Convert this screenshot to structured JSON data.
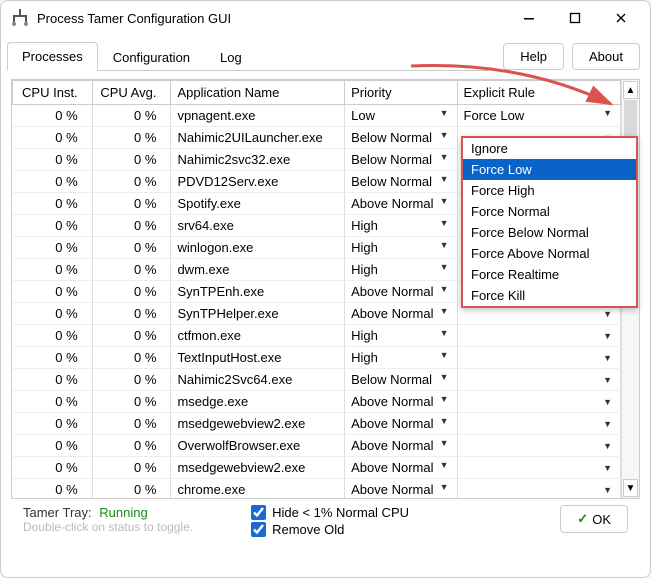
{
  "window": {
    "title": "Process Tamer Configuration GUI"
  },
  "buttons": {
    "help": "Help",
    "about": "About",
    "ok": "OK"
  },
  "tabs": {
    "processes": "Processes",
    "configuration": "Configuration",
    "log": "Log"
  },
  "columns": {
    "cpu_inst": "CPU Inst.",
    "cpu_avg": "CPU Avg.",
    "app_name": "Application Name",
    "priority": "Priority",
    "explicit_rule": "Explicit Rule"
  },
  "rows": [
    {
      "inst": "0 %",
      "avg": "0 %",
      "app": "vpnagent.exe",
      "pri": "Low",
      "rule": "Force Low"
    },
    {
      "inst": "0 %",
      "avg": "0 %",
      "app": "Nahimic2UILauncher.exe",
      "pri": "Below Normal",
      "rule": ""
    },
    {
      "inst": "0 %",
      "avg": "0 %",
      "app": "Nahimic2svc32.exe",
      "pri": "Below Normal",
      "rule": ""
    },
    {
      "inst": "0 %",
      "avg": "0 %",
      "app": "PDVD12Serv.exe",
      "pri": "Below Normal",
      "rule": ""
    },
    {
      "inst": "0 %",
      "avg": "0 %",
      "app": "Spotify.exe",
      "pri": "Above Normal",
      "rule": ""
    },
    {
      "inst": "0 %",
      "avg": "0 %",
      "app": "srv64.exe",
      "pri": "High",
      "rule": ""
    },
    {
      "inst": "0 %",
      "avg": "0 %",
      "app": "winlogon.exe",
      "pri": "High",
      "rule": ""
    },
    {
      "inst": "0 %",
      "avg": "0 %",
      "app": "dwm.exe",
      "pri": "High",
      "rule": ""
    },
    {
      "inst": "0 %",
      "avg": "0 %",
      "app": "SynTPEnh.exe",
      "pri": "Above Normal",
      "rule": ""
    },
    {
      "inst": "0 %",
      "avg": "0 %",
      "app": "SynTPHelper.exe",
      "pri": "Above Normal",
      "rule": ""
    },
    {
      "inst": "0 %",
      "avg": "0 %",
      "app": "ctfmon.exe",
      "pri": "High",
      "rule": ""
    },
    {
      "inst": "0 %",
      "avg": "0 %",
      "app": "TextInputHost.exe",
      "pri": "High",
      "rule": ""
    },
    {
      "inst": "0 %",
      "avg": "0 %",
      "app": "Nahimic2Svc64.exe",
      "pri": "Below Normal",
      "rule": ""
    },
    {
      "inst": "0 %",
      "avg": "0 %",
      "app": "msedge.exe",
      "pri": "Above Normal",
      "rule": ""
    },
    {
      "inst": "0 %",
      "avg": "0 %",
      "app": "msedgewebview2.exe",
      "pri": "Above Normal",
      "rule": ""
    },
    {
      "inst": "0 %",
      "avg": "0 %",
      "app": "OverwolfBrowser.exe",
      "pri": "Above Normal",
      "rule": ""
    },
    {
      "inst": "0 %",
      "avg": "0 %",
      "app": "msedgewebview2.exe",
      "pri": "Above Normal",
      "rule": ""
    },
    {
      "inst": "0 %",
      "avg": "0 %",
      "app": "chrome.exe",
      "pri": "Above Normal",
      "rule": ""
    }
  ],
  "dropdown_options": [
    "Ignore",
    "Force Low",
    "Force High",
    "Force Normal",
    "Force Below Normal",
    "Force Above Normal",
    "Force Realtime",
    "Force Kill"
  ],
  "dropdown_selected_index": 1,
  "status": {
    "tamer_tray_label": "Tamer Tray:",
    "tamer_tray_value": "Running",
    "tip": "Double-click on status to toggle."
  },
  "checkboxes": {
    "hide_label": "Hide < 1% Normal CPU",
    "remove_label": "Remove Old"
  }
}
